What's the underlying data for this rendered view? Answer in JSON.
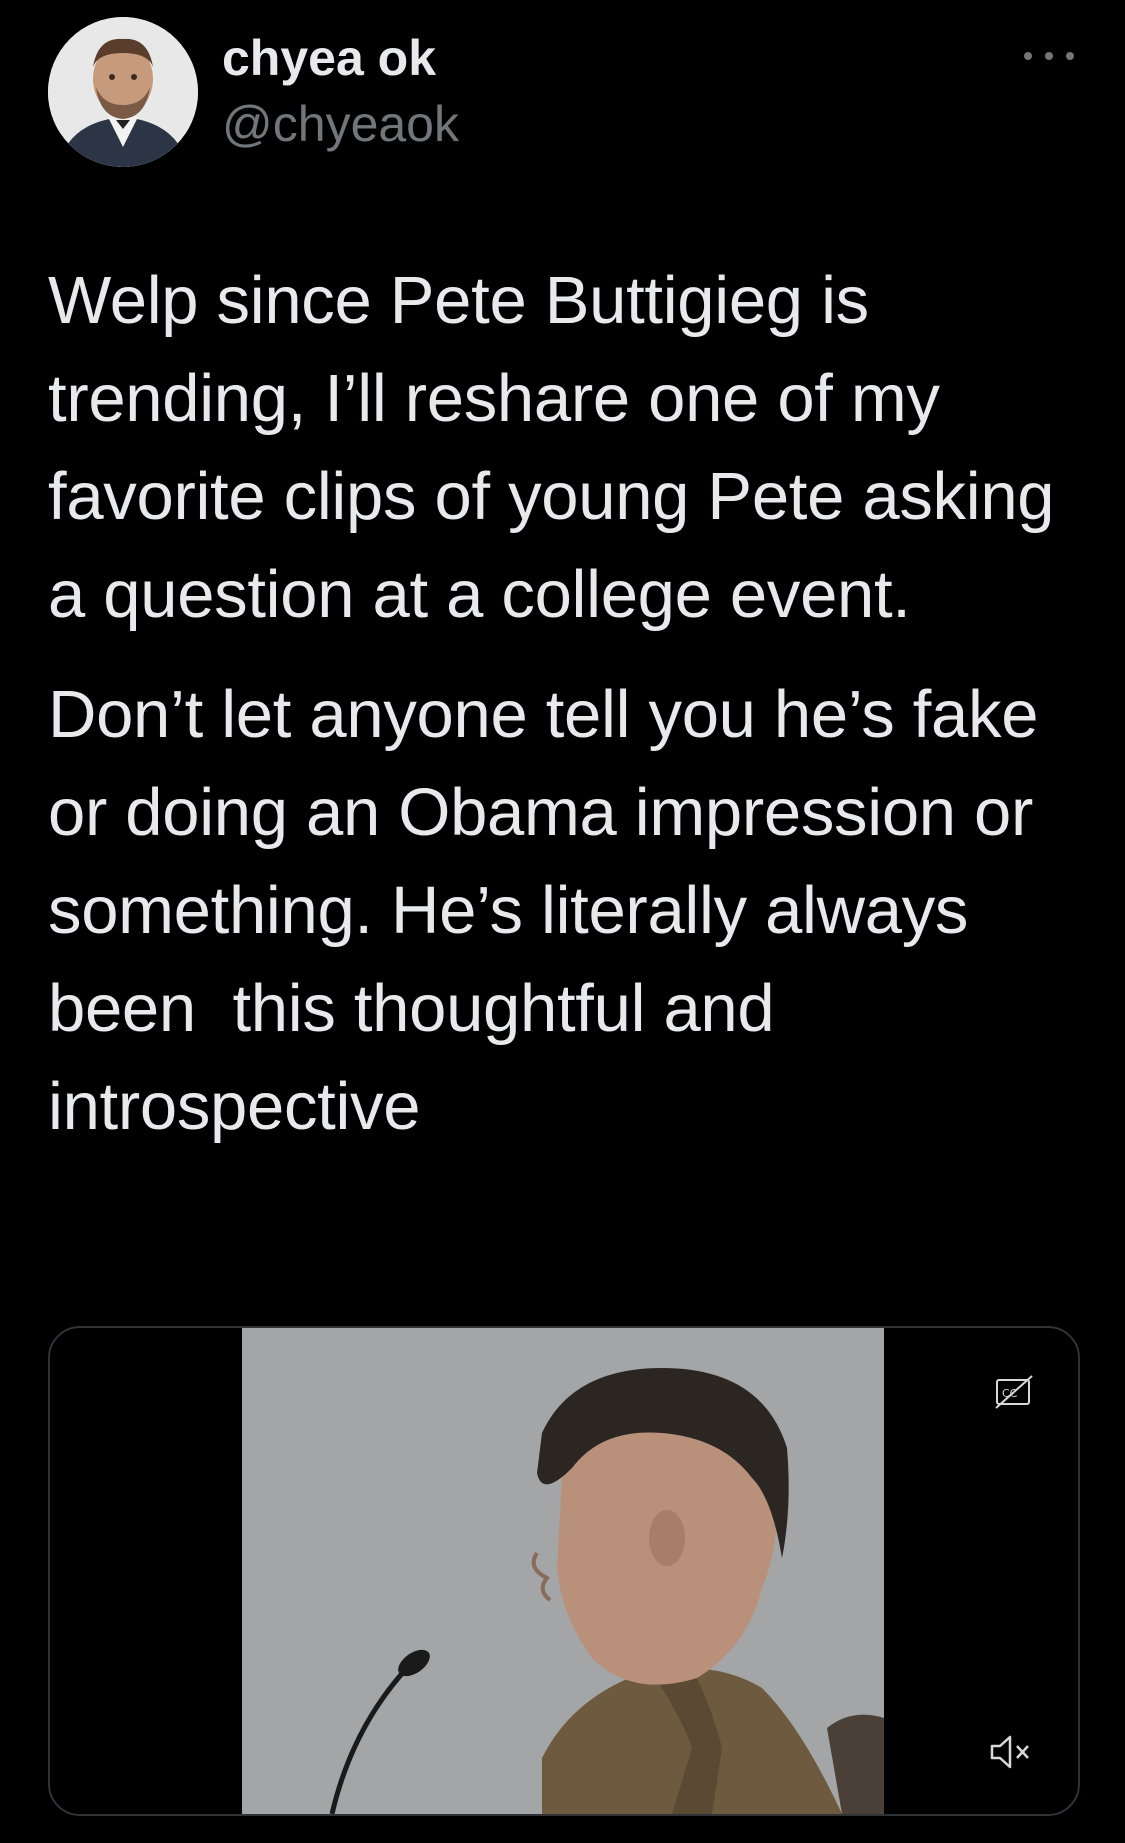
{
  "tweet": {
    "author": {
      "display_name": "chyea ok",
      "handle": "@chyeaok",
      "avatar_icon": "portrait-avatar"
    },
    "paragraphs": [
      "Welp since Pete Buttigieg is trending, I’ll reshare one of my favorite clips of young Pete asking a question at a college event.",
      "Don’t let anyone tell you he’s fake or doing an Obama impression or something. He’s literally always been  this thoughtful and introspective"
    ],
    "media": {
      "type": "video",
      "captions_icon": "closed-captions-icon",
      "volume_icon": "muted-speaker-icon"
    }
  },
  "colors": {
    "background": "#000000",
    "primary_text": "#e7e9ea",
    "secondary_text": "#71767b",
    "border": "#2f3336"
  }
}
